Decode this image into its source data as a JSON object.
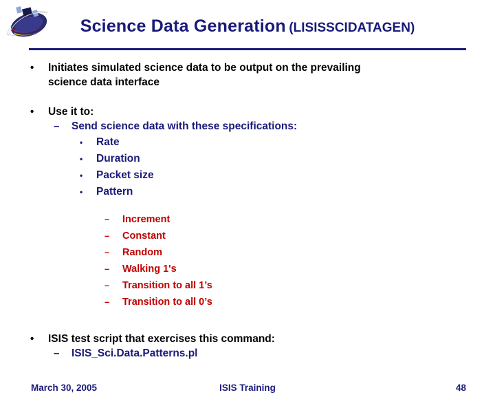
{
  "slide": {
    "title_main": "Science Data Generation",
    "title_sub": "(LISISSCIDATAGEN)",
    "logo_name": "isis-logo"
  },
  "bullets": {
    "b1_marker": "•",
    "b1_line1": "Initiates simulated science data to be output on the prevailing",
    "b1_line2": "science data interface",
    "b2_marker": "•",
    "b2_text": "Use it to:",
    "b2_sub_marker": "–",
    "b2_sub_text": "Send science data with these specifications:",
    "specs_marker": "•",
    "specs": [
      "Rate",
      "Duration",
      "Packet size",
      "Pattern"
    ],
    "patterns_marker": "–",
    "patterns": [
      "Increment",
      "Constant",
      "Random",
      "Walking 1's",
      "Transition to all 1’s",
      "Transition to all 0’s"
    ],
    "b3_marker": "•",
    "b3_text": "ISIS test script that exercises this command:",
    "b3_sub_marker": "–",
    "b3_sub_text": "ISIS_Sci.Data.Patterns.pl"
  },
  "footer": {
    "date": "March 30, 2005",
    "center": "ISIS Training",
    "page": "48"
  },
  "colors": {
    "title": "#1a1a7a",
    "accent_blue": "#1a1a7a",
    "accent_red": "#c00000",
    "text": "#000000"
  }
}
